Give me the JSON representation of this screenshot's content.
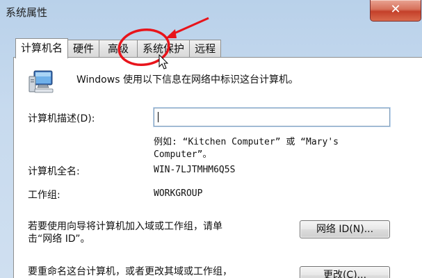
{
  "window": {
    "title": "系统属性",
    "close_label": "✕"
  },
  "tabs": [
    {
      "label": "计算机名",
      "active": true
    },
    {
      "label": "硬件",
      "active": false
    },
    {
      "label": "高级",
      "active": false
    },
    {
      "label": "系统保护",
      "active": false
    },
    {
      "label": "远程",
      "active": false
    }
  ],
  "panel": {
    "intro": "Windows 使用以下信息在网络中标识这台计算机。",
    "description_label": "计算机描述(D):",
    "description_value": "",
    "example_line1": "例如: “Kitchen Computer” 或 “Mary's",
    "example_line2": "Computer”。",
    "full_name_label": "计算机全名:",
    "full_name_value": "WIN-7LJTMHM6Q5S",
    "workgroup_label": "工作组:",
    "workgroup_value": "WORKGROUP",
    "network_id_text_line1": "若要使用向导将计算机加入域或工作组，请单",
    "network_id_text_line2": "击“网络 ID”。",
    "network_id_button": "网络 ID(N)...",
    "rename_text_line1": "要重命名这台计算机，或者更改其域或工作组，",
    "change_button": "更改(C)..."
  },
  "icons": {
    "computer": "computer-icon",
    "close": "close-icon"
  },
  "colors": {
    "annotation_red": "#e8141b",
    "close_button": "#c4402a"
  }
}
